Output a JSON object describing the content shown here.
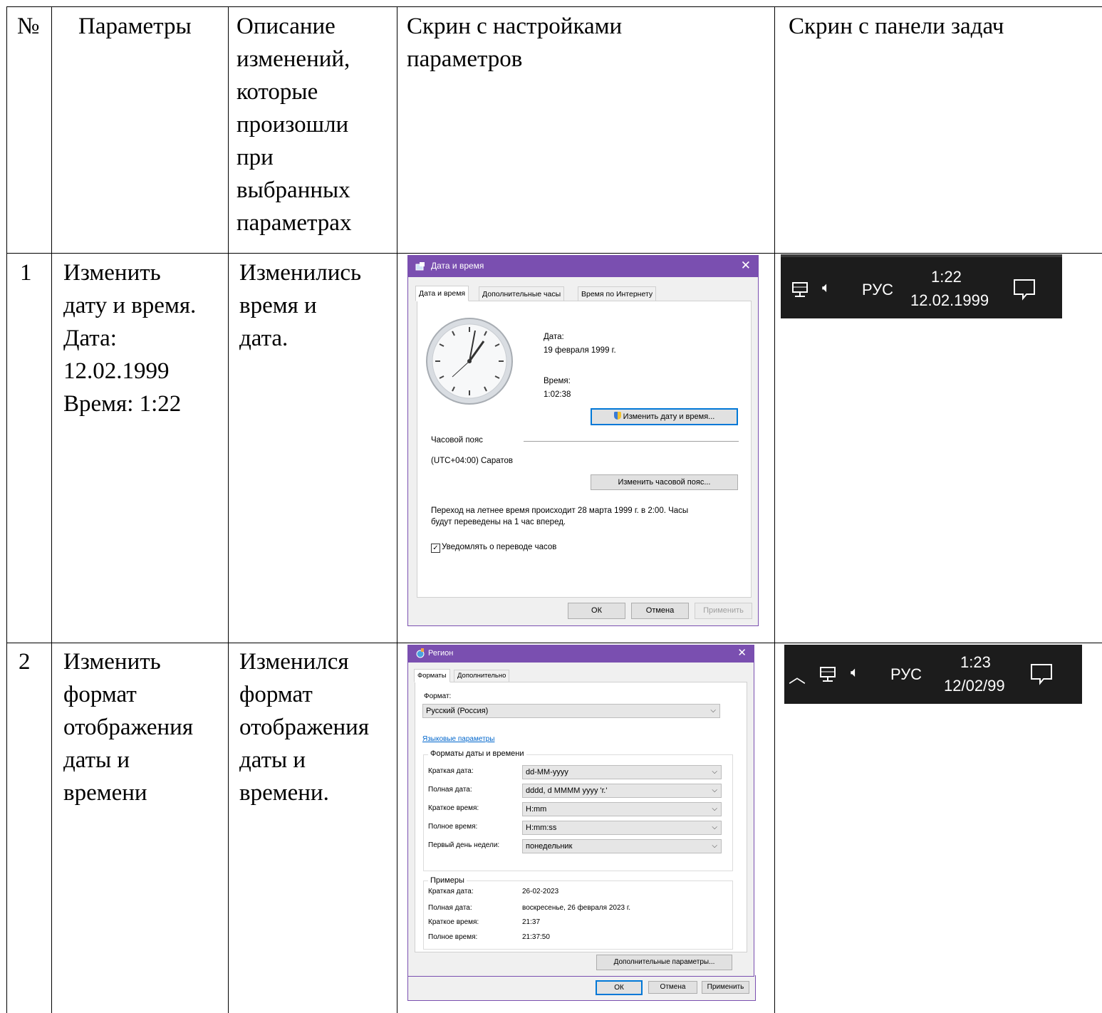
{
  "header": {
    "num": "№",
    "params": "Параметры",
    "desc_lines": [
      "Описание",
      "изменений,",
      "которые",
      "произошли",
      "при",
      "выбранных",
      "параметрах"
    ],
    "settings_lines": [
      "Скрин с настройками",
      "параметров"
    ],
    "taskbar": "Скрин с панели задач"
  },
  "rows": [
    {
      "num": "1",
      "param_lines": [
        "Изменить",
        "дату и время.",
        "Дата:",
        "12.02.1999",
        "Время: 1:22"
      ],
      "desc_lines": [
        "Изменились",
        "время и",
        "дата."
      ]
    },
    {
      "num": "2",
      "param_lines": [
        "Изменить",
        "формат",
        "отображения",
        "даты и",
        "времени"
      ],
      "desc_lines": [
        "Изменился",
        "формат",
        "отображения",
        "даты и",
        "времени."
      ]
    }
  ],
  "dialog1": {
    "title": "Дата и время",
    "tabs": [
      "Дата и время",
      "Дополнительные часы",
      "Время по Интернету"
    ],
    "date_label": "Дата:",
    "date_value": "19 февраля 1999 г.",
    "time_label": "Время:",
    "time_value": "1:02:38",
    "change_datetime_btn": "Изменить дату и время...",
    "timezone_label": "Часовой пояс",
    "timezone_value": "(UTC+04:00) Саратов",
    "change_tz_btn": "Изменить часовой пояс...",
    "dst_line1": "Переход на летнее время происходит 28 марта 1999 г. в 2:00. Часы",
    "dst_line2": "будут переведены на 1 час вперед.",
    "notify_checkbox": "Уведомлять о переводе часов",
    "notify_checked": true,
    "ok": "ОК",
    "cancel": "Отмена",
    "apply": "Применить",
    "accent_color": "#7a4fb0"
  },
  "dialog2": {
    "title": "Регион",
    "tabs": [
      "Форматы",
      "Дополнительно"
    ],
    "format_label": "Формат:",
    "format_value": "Русский (Россия)",
    "lang_link": "Языковые параметры",
    "formats_group": "Форматы даты и времени",
    "fields": [
      {
        "label": "Краткая дата:",
        "value": "dd-MM-yyyy"
      },
      {
        "label": "Полная дата:",
        "value": "dddd, d MMMM yyyy 'г.'"
      },
      {
        "label": "Краткое время:",
        "value": "H:mm"
      },
      {
        "label": "Полное время:",
        "value": "H:mm:ss"
      },
      {
        "label": "Первый день недели:",
        "value": "понедельник"
      }
    ],
    "examples_group": "Примеры",
    "examples": [
      {
        "label": "Краткая дата:",
        "value": "26-02-2023"
      },
      {
        "label": "Полная дата:",
        "value": "воскресенье, 26 февраля 2023 г."
      },
      {
        "label": "Краткое время:",
        "value": "21:37"
      },
      {
        "label": "Полное время:",
        "value": "21:37:50"
      }
    ],
    "advanced_btn": "Дополнительные параметры...",
    "ok": "ОК",
    "cancel": "Отмена",
    "apply": "Применить"
  },
  "taskbar1": {
    "lang": "РУС",
    "time": "1:22",
    "date": "12.02.1999"
  },
  "taskbar2": {
    "lang": "РУС",
    "time": "1:23",
    "date": "12/02/99"
  }
}
